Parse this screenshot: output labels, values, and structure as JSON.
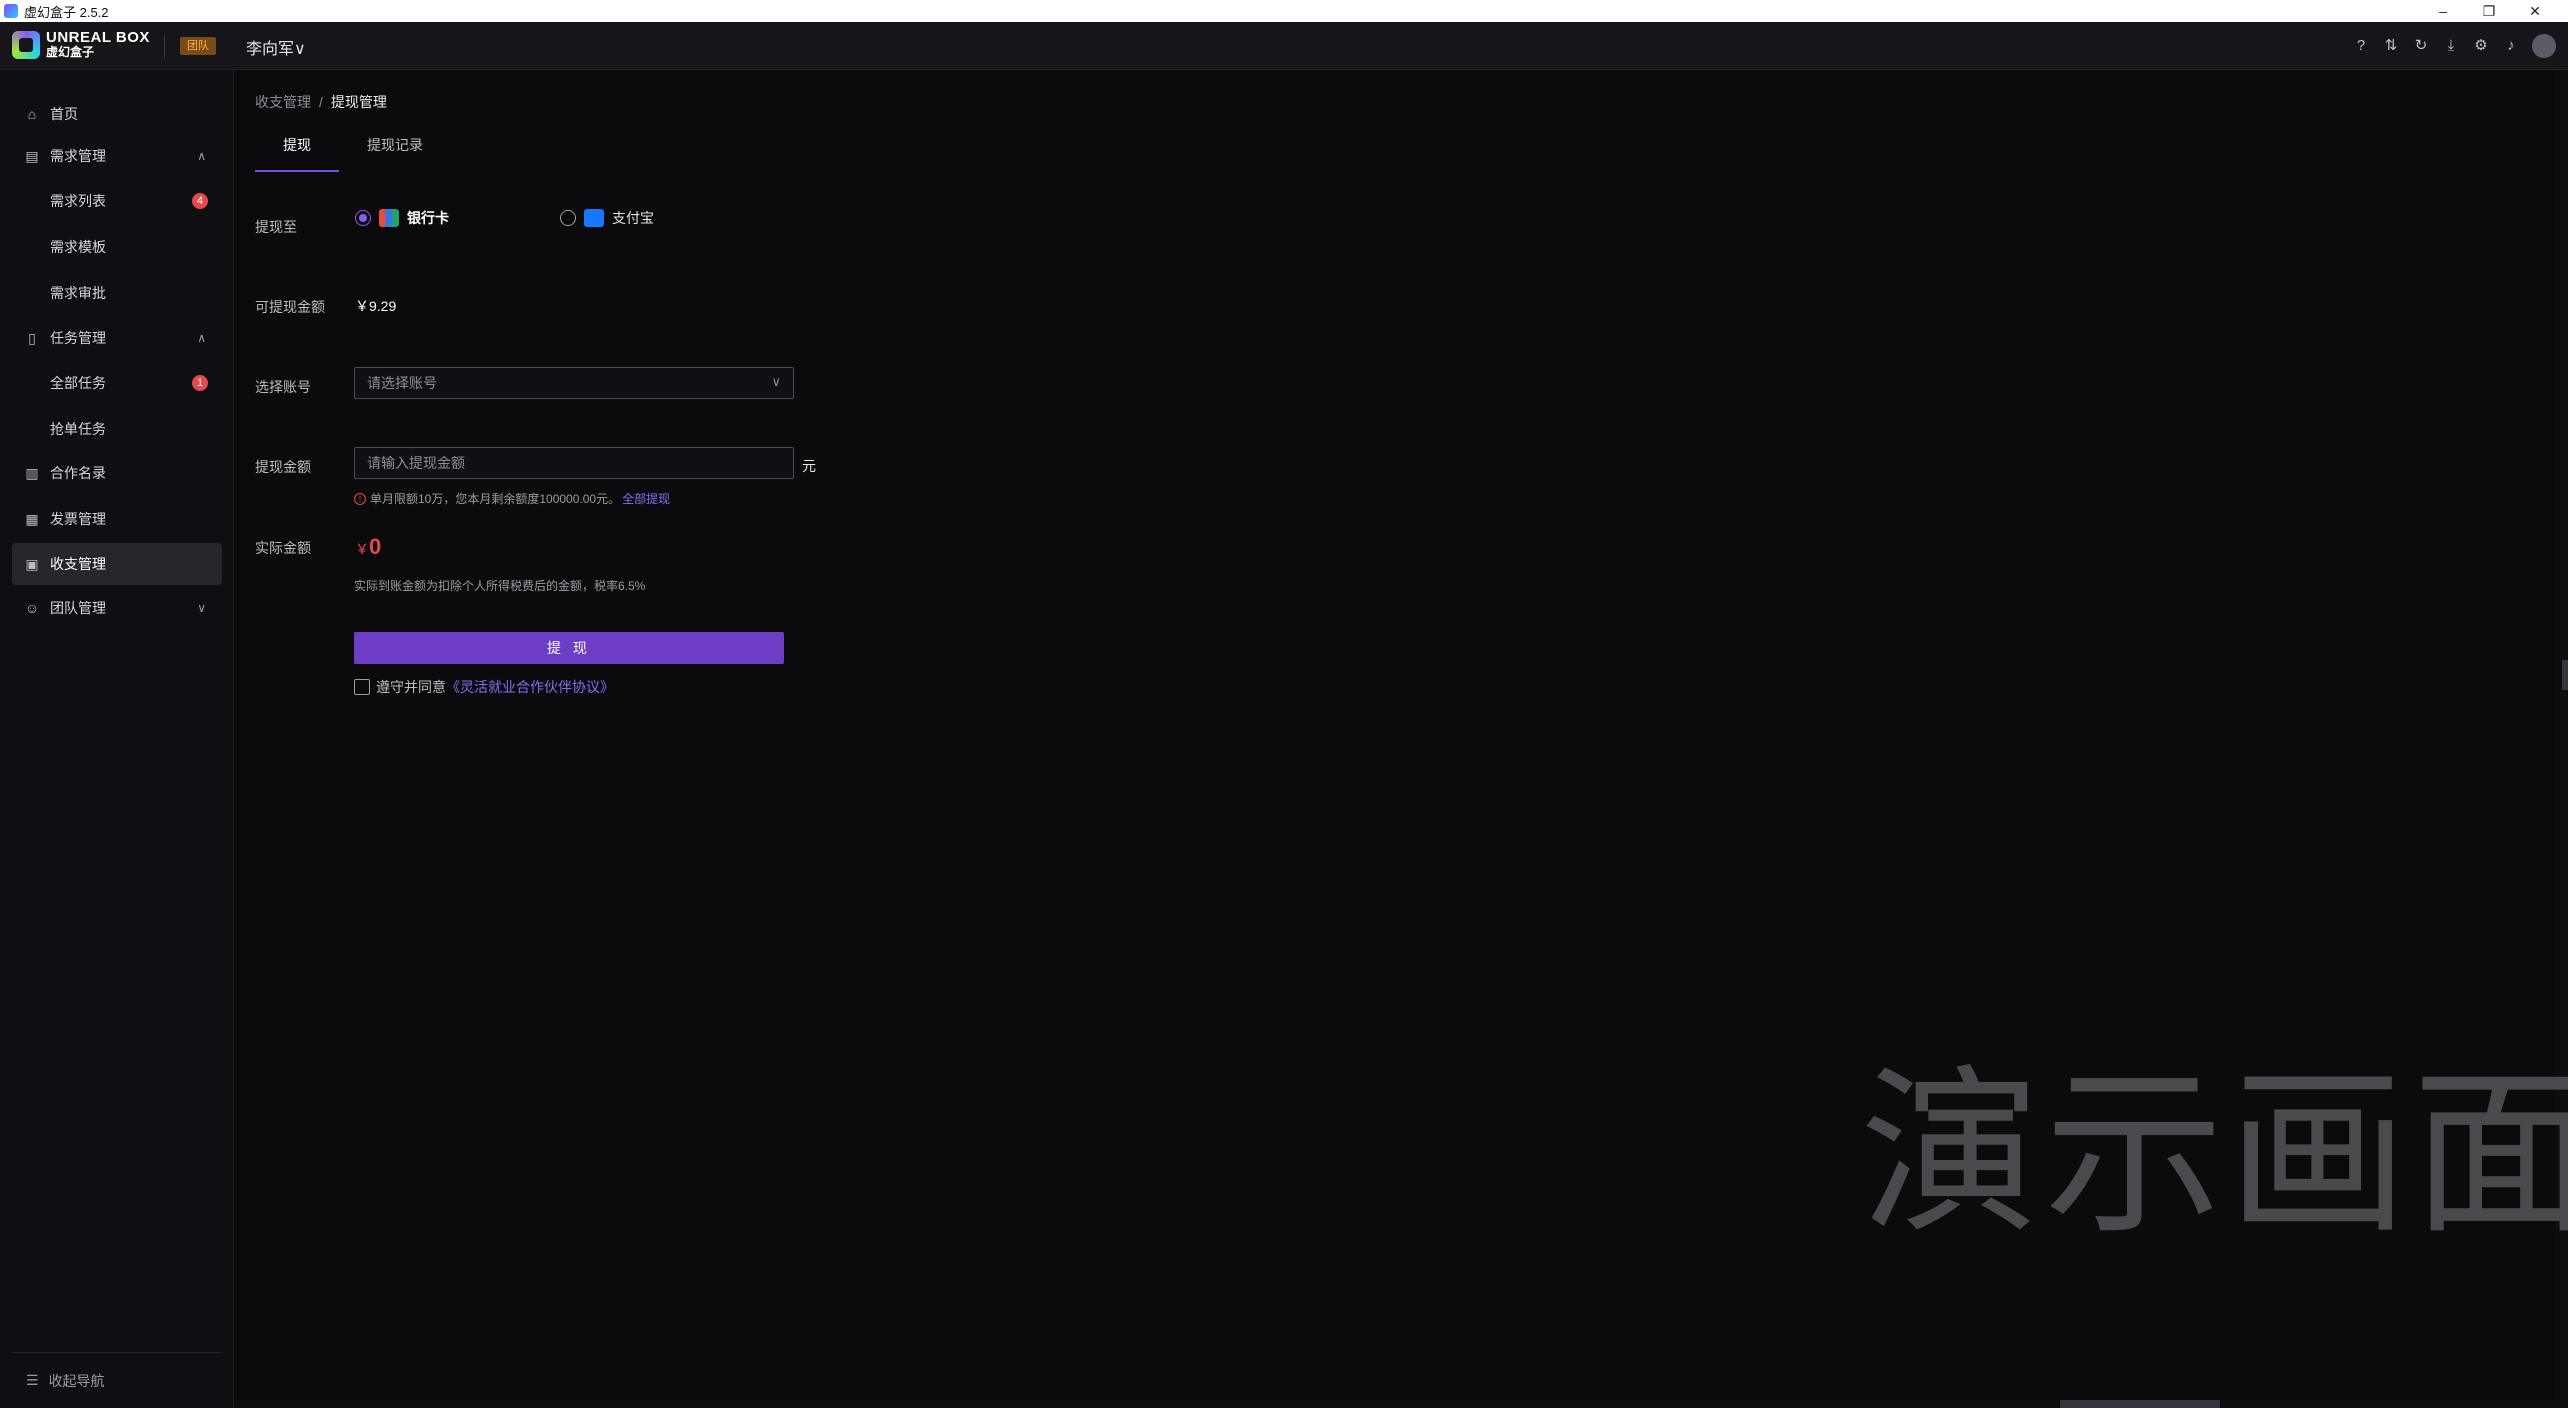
{
  "window": {
    "title": "虚幻盒子 2.5.2"
  },
  "topbar": {
    "logo_en": "UNREAL BOX",
    "logo_zh": "虚幻盒子",
    "team_badge": "团队",
    "user_name": "李向军",
    "icons": [
      "help-icon",
      "transfer-icon",
      "refresh-icon",
      "download-icon",
      "settings-icon",
      "bell-icon",
      "avatar"
    ]
  },
  "sidebar": {
    "items": [
      {
        "label": "首页",
        "icon": "home-icon"
      },
      {
        "label": "需求管理",
        "icon": "table-icon",
        "expanded": true
      },
      {
        "label": "需求列表",
        "badge": "4"
      },
      {
        "label": "需求模板"
      },
      {
        "label": "需求审批"
      },
      {
        "label": "任务管理",
        "icon": "clipboard-icon",
        "expanded": true
      },
      {
        "label": "全部任务",
        "badge": "1"
      },
      {
        "label": "抢单任务"
      },
      {
        "label": "合作名录",
        "icon": "book-icon"
      },
      {
        "label": "发票管理",
        "icon": "invoice-icon"
      },
      {
        "label": "收支管理",
        "icon": "wallet-icon",
        "active": true
      },
      {
        "label": "团队管理",
        "icon": "team-icon",
        "expanded": false
      }
    ],
    "collapse_label": "收起导航"
  },
  "main": {
    "breadcrumb": {
      "parent": "收支管理",
      "sep": "/",
      "current": "提现管理"
    },
    "tabs": [
      {
        "label": "提现",
        "active": true
      },
      {
        "label": "提现记录"
      }
    ],
    "form": {
      "withdraw_to_label": "提现至",
      "options": [
        {
          "label": "银行卡",
          "selected": true
        },
        {
          "label": "支付宝",
          "selected": false
        }
      ],
      "available_label": "可提现金额",
      "available_value": "￥9.29",
      "account_label": "选择账号",
      "account_placeholder": "请选择账号",
      "amount_label": "提现金额",
      "amount_placeholder": "请输入提现金额",
      "unit": "元",
      "limit_hint": "单月限额10万，您本月剩余额度100000.00元。",
      "withdraw_all_link": "全部提现",
      "actual_label": "实际金额",
      "actual_currency": "￥",
      "actual_value": "0",
      "actual_note": "实际到账金额为扣除个人所得税费后的金额，税率6.5%",
      "submit_label": "提 现",
      "agree_text": "遵守并同意",
      "agree_link": "《灵活就业合作伙伴协议》"
    },
    "watermark": "演示画面"
  },
  "colors": {
    "accent": "#6e3dc5",
    "link": "#8b6cf6",
    "danger": "#e5484d",
    "badge_bg": "#7a4b14"
  }
}
